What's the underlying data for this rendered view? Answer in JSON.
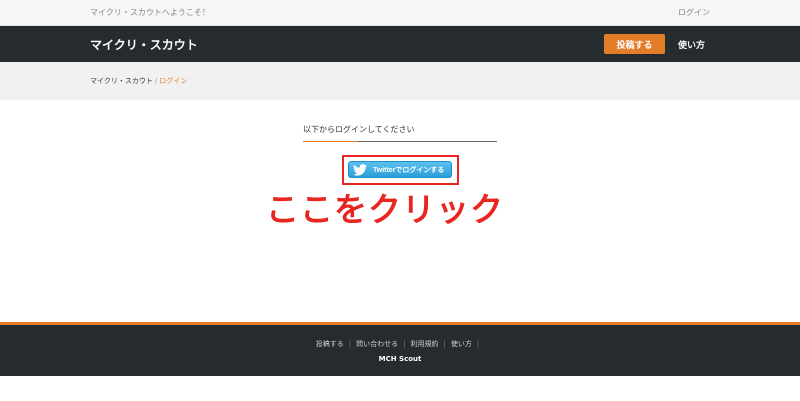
{
  "topbar": {
    "welcome": "マイクリ・スカウトへようこそ！",
    "login": "ログイン"
  },
  "header": {
    "site_title": "マイクリ・スカウト",
    "post_button": "投稿する",
    "howto": "使い方"
  },
  "breadcrumb": {
    "home": "マイクリ・スカウト",
    "separator": "/",
    "current": "ログイン"
  },
  "login_panel": {
    "heading": "以下からログインしてください",
    "twitter_button": "Twitterでログインする",
    "twitter_icon": "twitter-bird-icon"
  },
  "annotation": {
    "text": "ここをクリック",
    "color": "#e8261f"
  },
  "footer": {
    "links": [
      "投稿する",
      "問い合わせる",
      "利用規約",
      "使い方"
    ],
    "brand": "MCH Scout"
  },
  "colors": {
    "accent": "#e47d27",
    "dark": "#262b2f",
    "twitter": "#2a9fd8"
  }
}
